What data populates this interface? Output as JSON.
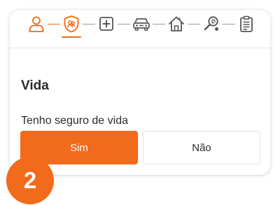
{
  "colors": {
    "accent": "#f26a1b",
    "text": "#2b2b2b",
    "inactive_icon": "#555555",
    "border": "#e3e3e3"
  },
  "stepper": {
    "steps": [
      {
        "icon": "person-icon",
        "state": "completed"
      },
      {
        "icon": "life-insurance-shield-icon",
        "state": "active"
      },
      {
        "icon": "health-cross-icon",
        "state": "pending"
      },
      {
        "icon": "car-icon",
        "state": "pending"
      },
      {
        "icon": "home-icon",
        "state": "pending"
      },
      {
        "icon": "sports-racket-icon",
        "state": "pending"
      },
      {
        "icon": "clipboard-icon",
        "state": "pending"
      }
    ]
  },
  "section": {
    "title": "Vida",
    "question": "Tenho seguro de vida"
  },
  "options": {
    "yes_label": "Sim",
    "no_label": "Não",
    "selected": "Sim"
  },
  "badge": {
    "number": "2"
  }
}
